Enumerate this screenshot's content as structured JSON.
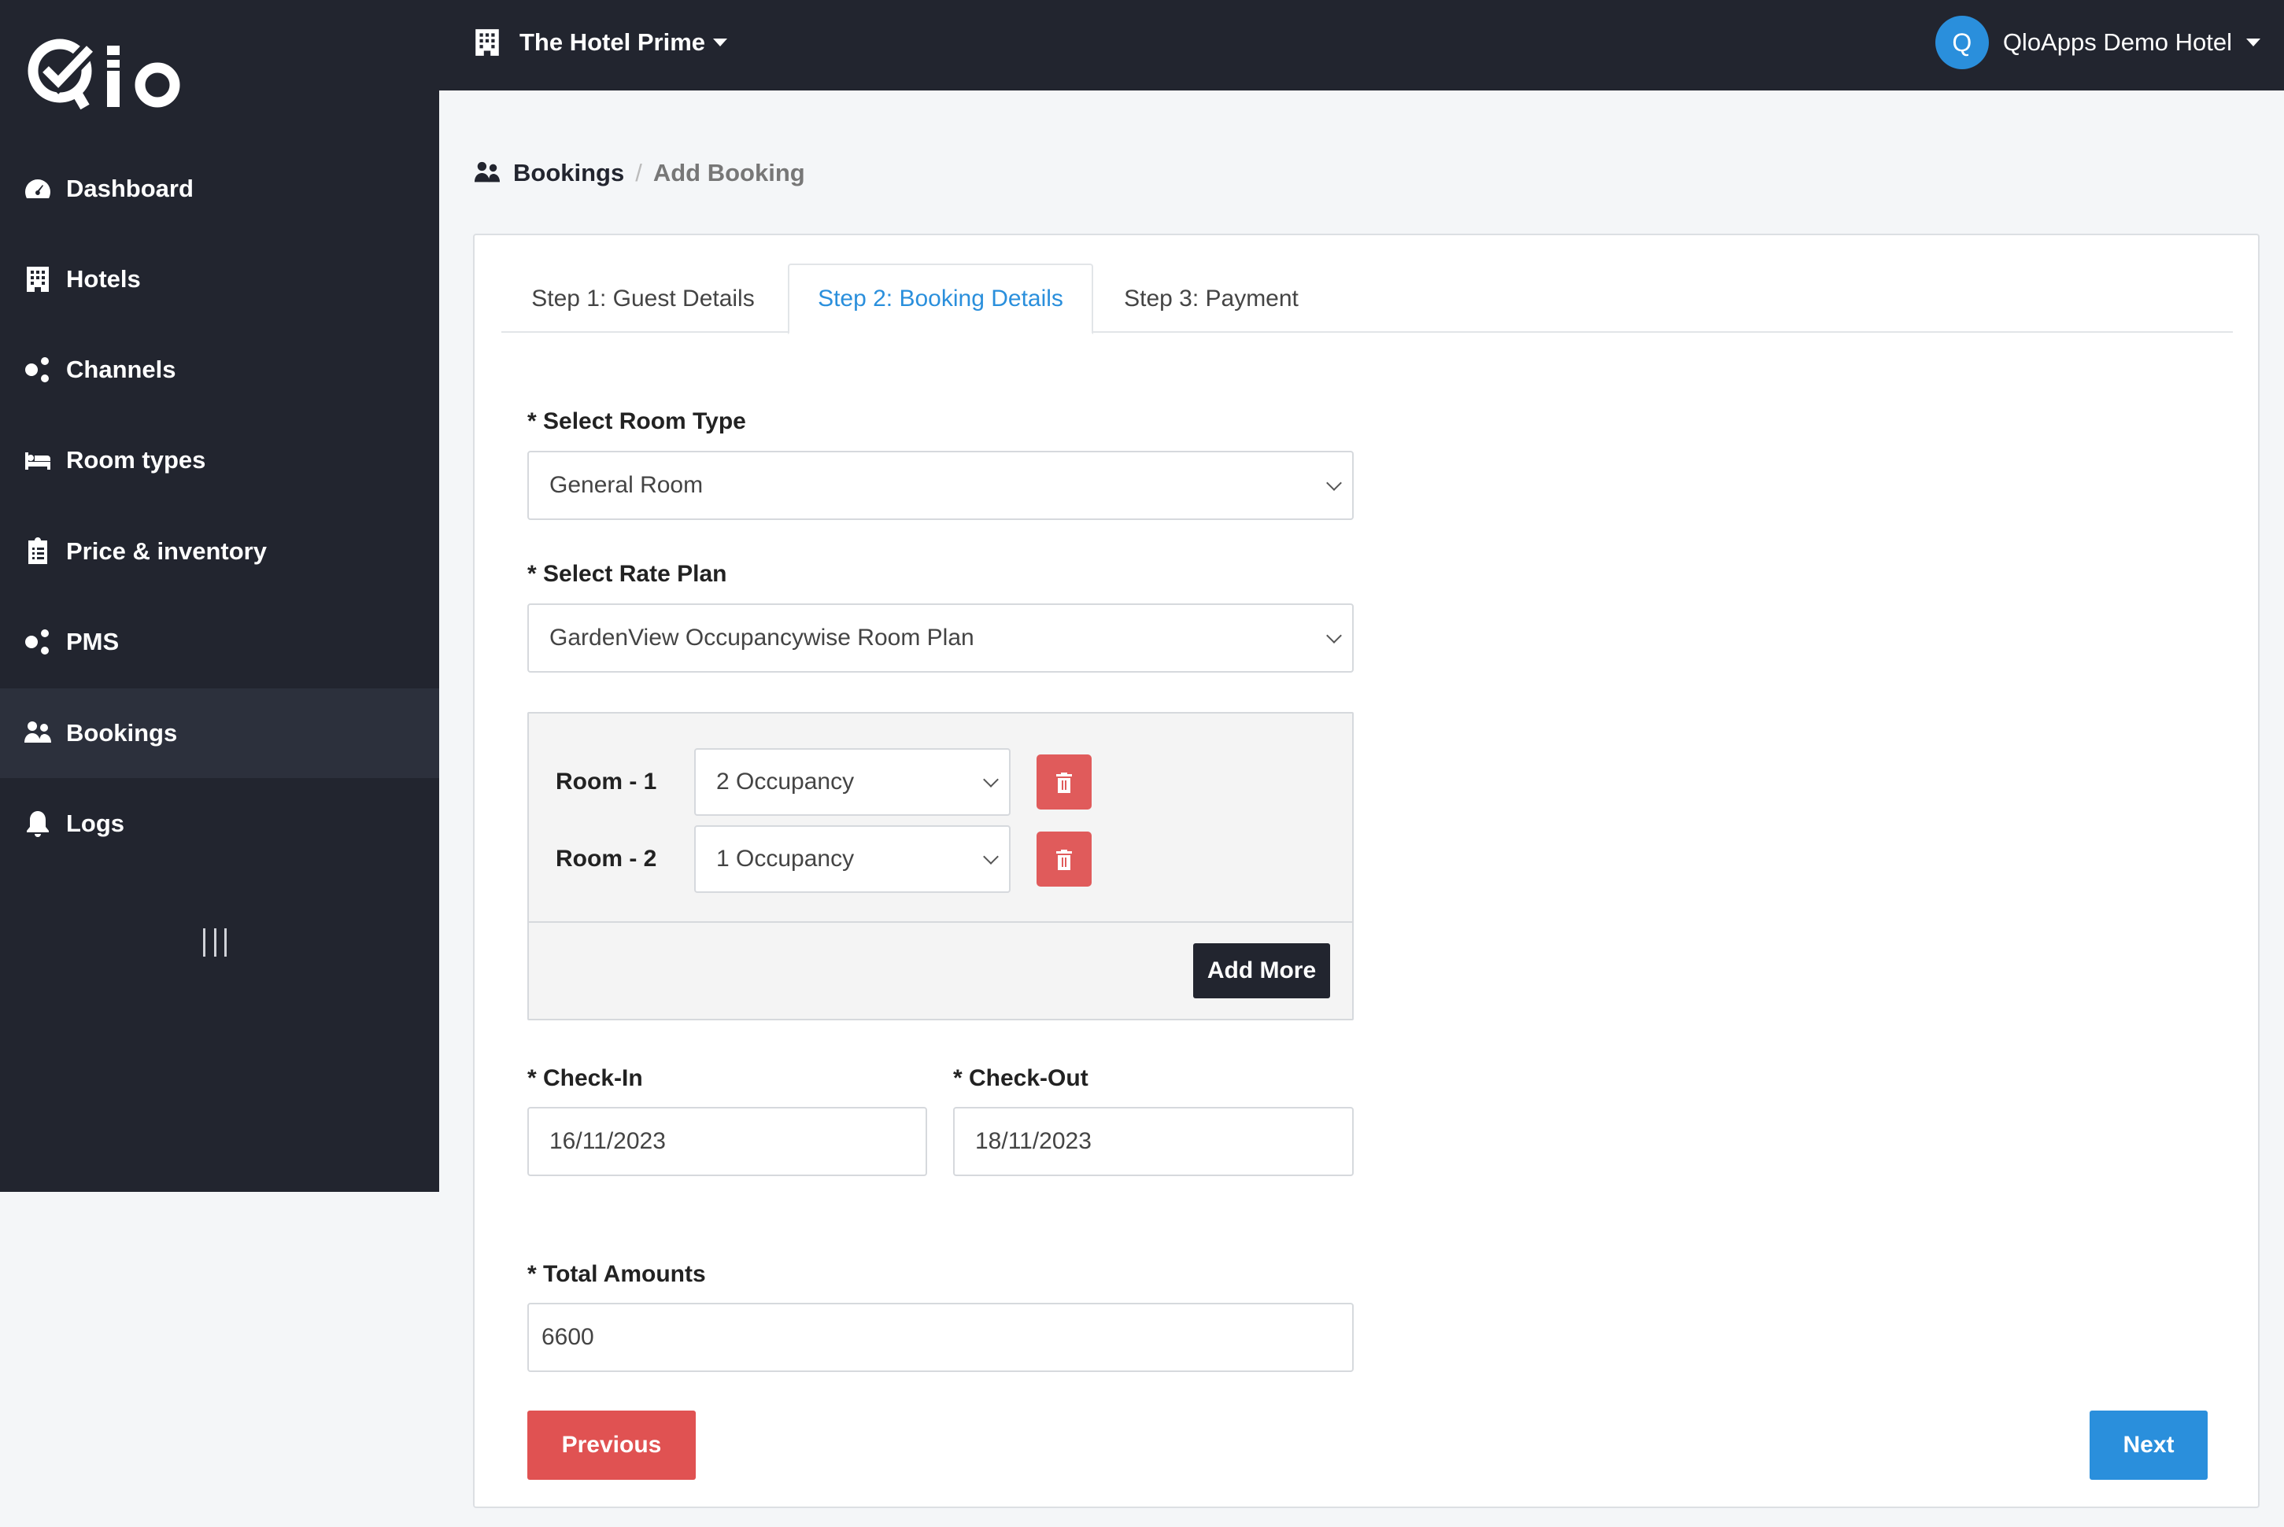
{
  "brand": {
    "logo_text": "Qlo"
  },
  "sidebar": {
    "items": [
      {
        "label": "Dashboard",
        "icon": "dashboard-gauge-icon"
      },
      {
        "label": "Hotels",
        "icon": "building-icon"
      },
      {
        "label": "Channels",
        "icon": "channels-dots-icon"
      },
      {
        "label": "Room types",
        "icon": "bed-icon"
      },
      {
        "label": "Price & inventory",
        "icon": "clipboard-list-icon"
      },
      {
        "label": "PMS",
        "icon": "pms-dots-icon"
      },
      {
        "label": "Bookings",
        "icon": "users-icon",
        "active": true
      },
      {
        "label": "Logs",
        "icon": "bell-icon"
      }
    ],
    "collapse_icon": "collapse-bars-icon"
  },
  "topbar": {
    "hotel_name": "The Hotel Prime",
    "user_initial": "Q",
    "user_name": "QloApps Demo Hotel"
  },
  "breadcrumb": {
    "section": "Bookings",
    "current": "Add Booking"
  },
  "tabs": [
    {
      "label": "Step 1: Guest Details"
    },
    {
      "label": "Step 2: Booking Details",
      "active": true
    },
    {
      "label": "Step 3: Payment"
    }
  ],
  "form": {
    "room_type": {
      "label": "* Select Room Type",
      "value": "General Room"
    },
    "rate_plan": {
      "label": "* Select Rate Plan",
      "value": "GardenView Occupancywise Room Plan"
    },
    "rooms": [
      {
        "label": "Room - 1",
        "occupancy": "2 Occupancy"
      },
      {
        "label": "Room - 2",
        "occupancy": "1 Occupancy"
      }
    ],
    "add_more_label": "Add More",
    "check_in": {
      "label": "* Check-In",
      "value": "16/11/2023"
    },
    "check_out": {
      "label": "* Check-Out",
      "value": "18/11/2023"
    },
    "total": {
      "label": "* Total Amounts",
      "value": "6600"
    }
  },
  "actions": {
    "previous_label": "Previous",
    "next_label": "Next"
  },
  "colors": {
    "sidebar_bg": "#22252f",
    "accent_blue": "#2a8fdc",
    "danger_red": "#e05252",
    "page_bg": "#f4f6f8"
  }
}
